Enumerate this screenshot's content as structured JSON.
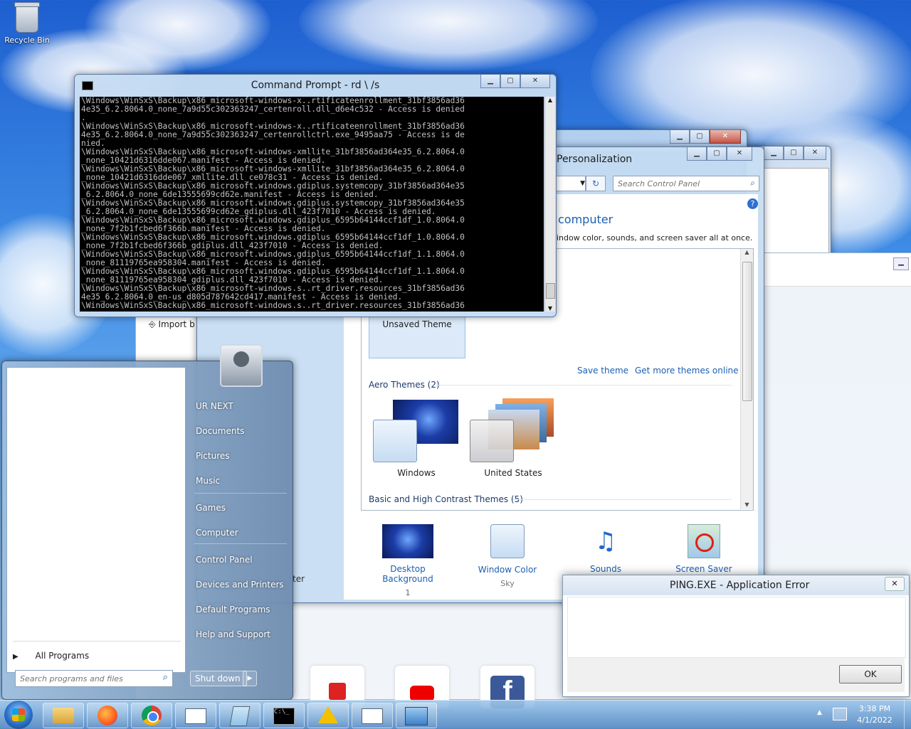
{
  "desktop": {
    "recycle_bin_label": "Recycle Bin"
  },
  "cmd": {
    "title": "Command Prompt - rd  \\ /s",
    "lines": [
      "\\Windows\\WinSxS\\Backup\\x86_microsoft-windows-x..rtificateenrollment_31bf3856ad36",
      "4e35_6.2.8064.0_none_7a9d55c302363247_certenroll.dll_d6e4c532 - Access is denied",
      ".",
      "\\Windows\\WinSxS\\Backup\\x86_microsoft-windows-x..rtificateenrollment_31bf3856ad36",
      "4e35_6.2.8064.0_none_7a9d55c302363247_certenrollctrl.exe_9495aa75 - Access is de",
      "nied.",
      "\\Windows\\WinSxS\\Backup\\x86_microsoft-windows-xmllite_31bf3856ad364e35_6.2.8064.0",
      "_none_10421d6316dde067.manifest - Access is denied.",
      "\\Windows\\WinSxS\\Backup\\x86_microsoft-windows-xmllite_31bf3856ad364e35_6.2.8064.0",
      "_none_10421d6316dde067_xmllite.dll_ce078c31 - Access is denied.",
      "\\Windows\\WinSxS\\Backup\\x86_microsoft.windows.gdiplus.systemcopy_31bf3856ad364e35",
      "_6.2.8064.0_none_6de13555699cd62e.manifest - Access is denied.",
      "\\Windows\\WinSxS\\Backup\\x86_microsoft.windows.gdiplus.systemcopy_31bf3856ad364e35",
      "_6.2.8064.0_none_6de13555699cd62e_gdiplus.dll_423f7010 - Access is denied.",
      "\\Windows\\WinSxS\\Backup\\x86_microsoft.windows.gdiplus_6595b64144ccf1df_1.0.8064.0",
      "_none_7f2b1fcbed6f366b.manifest - Access is denied.",
      "\\Windows\\WinSxS\\Backup\\x86_microsoft.windows.gdiplus_6595b64144ccf1df_1.0.8064.0",
      "_none_7f2b1fcbed6f366b_gdiplus.dll_423f7010 - Access is denied.",
      "\\Windows\\WinSxS\\Backup\\x86_microsoft.windows.gdiplus_6595b64144ccf1df_1.1.8064.0",
      "_none_81119765ea958304.manifest - Access is denied.",
      "\\Windows\\WinSxS\\Backup\\x86_microsoft.windows.gdiplus_6595b64144ccf1df_1.1.8064.0",
      "_none_81119765ea958304_gdiplus.dll_423f7010 - Access is denied.",
      "\\Windows\\WinSxS\\Backup\\x86_microsoft-windows.s..rt_driver.resources_31bf3856ad36",
      "4e35_6.2.8064.0_en-us_d805d787642cd417.manifest - Access is denied.",
      "\\Windows\\WinSxS\\Backup\\x86_microsoft-windows.s..rt_driver.resources_31bf3856ad36"
    ]
  },
  "personalization": {
    "title": "Personalization",
    "search_placeholder": "Search Control Panel",
    "heading": "computer",
    "subtext": "indow color, sounds, and screen saver all at once.",
    "unsaved_theme": "Unsaved Theme",
    "save_theme": "Save theme",
    "get_more": "Get more themes online",
    "aero_header": "Aero Themes (2)",
    "theme_windows": "Windows",
    "theme_us": "United States",
    "basic_header": "Basic and High Contrast Themes (5)",
    "bottom": [
      {
        "label": "Desktop Background",
        "sub": "1"
      },
      {
        "label": "Window Color",
        "sub": "Sky"
      },
      {
        "label": "Sounds",
        "sub": ""
      },
      {
        "label": "Screen Saver",
        "sub": ""
      }
    ],
    "partial_text": "ter"
  },
  "import_label": "Import b",
  "start_menu": {
    "right_items": [
      "UR NEXT",
      "Documents",
      "Pictures",
      "Music",
      "Games",
      "Computer",
      "Control Panel",
      "Devices and Printers",
      "Default Programs",
      "Help and Support"
    ],
    "all_programs": "All Programs",
    "search_placeholder": "Search programs and files",
    "shutdown": "Shut down"
  },
  "error_dialog": {
    "title": "PING.EXE - Application Error",
    "ok": "OK"
  },
  "taskbar": {
    "time": "3:38 PM",
    "date": "4/1/2022"
  }
}
